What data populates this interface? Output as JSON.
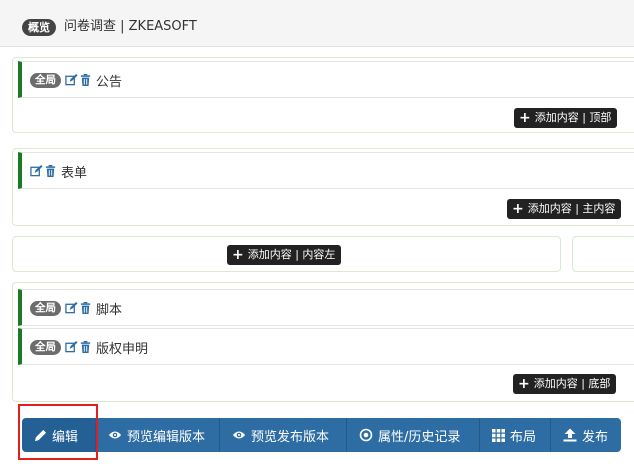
{
  "header": {
    "overview_label": "概览",
    "title": "问卷调查 | ZKEASOFT"
  },
  "zones": {
    "top": {
      "add_label": "添加内容 | 顶部"
    },
    "main": {
      "add_label": "添加内容 | 主内容"
    },
    "left": {
      "add_label": "添加内容 | 内容左"
    },
    "bottom": {
      "add_label": "添加内容 | 底部"
    }
  },
  "widgets": {
    "top_0": {
      "scope": "全局",
      "name": "公告"
    },
    "main_0": {
      "name": "表单"
    },
    "bottom_0": {
      "scope": "全局",
      "name": "脚本"
    },
    "bottom_1": {
      "scope": "全局",
      "name": "版权申明"
    }
  },
  "toolbar": {
    "edit": "编辑",
    "preview_draft": "预览编辑版本",
    "preview_published": "预览发布版本",
    "properties": "属性/历史记录",
    "layout": "布局",
    "publish": "发布"
  },
  "colors": {
    "accent": "#2e6da4",
    "widget_bar": "#1b7a22",
    "highlight": "#e02020"
  }
}
